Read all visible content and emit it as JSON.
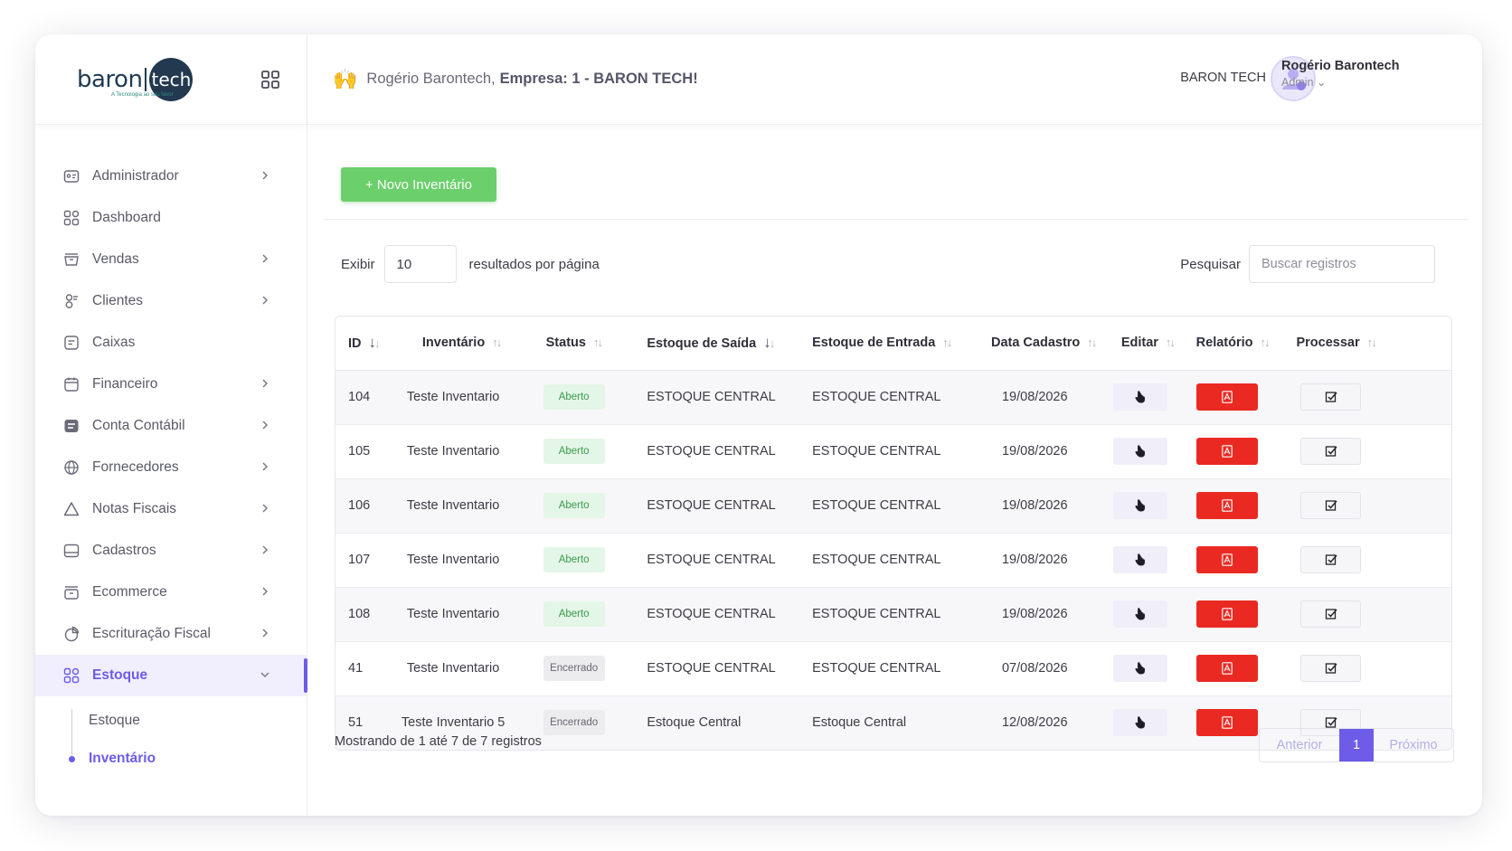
{
  "brand": {
    "logo_left": "baron",
    "logo_right": "tech",
    "tagline": "A Tecnologia ao seu favor"
  },
  "sidebar": {
    "items": [
      {
        "label": "Administrador",
        "icon": "id-card-icon",
        "chevron": true
      },
      {
        "label": "Dashboard",
        "icon": "dashboard-icon",
        "chevron": false
      },
      {
        "label": "Vendas",
        "icon": "basket-icon",
        "chevron": true
      },
      {
        "label": "Clientes",
        "icon": "users-icon",
        "chevron": true
      },
      {
        "label": "Caixas",
        "icon": "cash-register-icon",
        "chevron": false
      },
      {
        "label": "Financeiro",
        "icon": "calendar-icon",
        "chevron": true
      },
      {
        "label": "Conta Contábil",
        "icon": "ledger-icon",
        "chevron": true
      },
      {
        "label": "Fornecedores",
        "icon": "globe-icon",
        "chevron": true
      },
      {
        "label": "Notas Fiscais",
        "icon": "triangle-icon",
        "chevron": true
      },
      {
        "label": "Cadastros",
        "icon": "form-icon",
        "chevron": true
      },
      {
        "label": "Ecommerce",
        "icon": "store-icon",
        "chevron": true
      },
      {
        "label": "Escrituração Fiscal",
        "icon": "pie-chart-icon",
        "chevron": true
      },
      {
        "label": "Estoque",
        "icon": "stock-icon",
        "chevron": true,
        "active": true
      }
    ],
    "submenu": [
      {
        "label": "Estoque"
      },
      {
        "label": "Inventário",
        "active": true
      }
    ]
  },
  "header": {
    "greeting_name": "Rogério Barontech,",
    "greeting_company": "Empresa: 1 - BARON TECH!",
    "company": "BARON TECH",
    "user_name": "Rogério Barontech",
    "user_role": "Admin"
  },
  "toolbar": {
    "new_label": "+ Novo Inventário"
  },
  "controls": {
    "show_label": "Exibir",
    "page_size": "10",
    "per_page_label": "resultados por página",
    "search_label": "Pesquisar",
    "search_placeholder": "Buscar registros"
  },
  "table": {
    "columns": [
      "ID",
      "Inventário",
      "Status",
      "Estoque de Saída",
      "Estoque de Entrada",
      "Data Cadastro",
      "Editar",
      "Relatório",
      "Processar"
    ],
    "rows": [
      {
        "id": "104",
        "inventario": "Teste Inventario",
        "status": "Aberto",
        "saida": "ESTOQUE CENTRAL",
        "entrada": "ESTOQUE CENTRAL",
        "data": "19/08/2026"
      },
      {
        "id": "105",
        "inventario": "Teste Inventario",
        "status": "Aberto",
        "saida": "ESTOQUE CENTRAL",
        "entrada": "ESTOQUE CENTRAL",
        "data": "19/08/2026"
      },
      {
        "id": "106",
        "inventario": "Teste Inventario",
        "status": "Aberto",
        "saida": "ESTOQUE CENTRAL",
        "entrada": "ESTOQUE CENTRAL",
        "data": "19/08/2026"
      },
      {
        "id": "107",
        "inventario": "Teste Inventario",
        "status": "Aberto",
        "saida": "ESTOQUE CENTRAL",
        "entrada": "ESTOQUE CENTRAL",
        "data": "19/08/2026"
      },
      {
        "id": "108",
        "inventario": "Teste Inventario",
        "status": "Aberto",
        "saida": "ESTOQUE CENTRAL",
        "entrada": "ESTOQUE CENTRAL",
        "data": "19/08/2026"
      },
      {
        "id": "41",
        "inventario": "Teste Inventario",
        "status": "Encerrado",
        "saida": "ESTOQUE CENTRAL",
        "entrada": "ESTOQUE CENTRAL",
        "data": "07/08/2026"
      },
      {
        "id": "51",
        "inventario": "Teste Inventario 5",
        "status": "Encerrado",
        "saida": "Estoque Central",
        "entrada": "Estoque Central",
        "data": "12/08/2026"
      }
    ]
  },
  "footer": {
    "info": "Mostrando de 1 até 7 de 7 registros",
    "prev": "Anterior",
    "current_page": "1",
    "next": "Próximo"
  },
  "colors": {
    "accent": "#6d5ce8",
    "success": "#6bcf6b",
    "danger": "#ea2a22"
  }
}
